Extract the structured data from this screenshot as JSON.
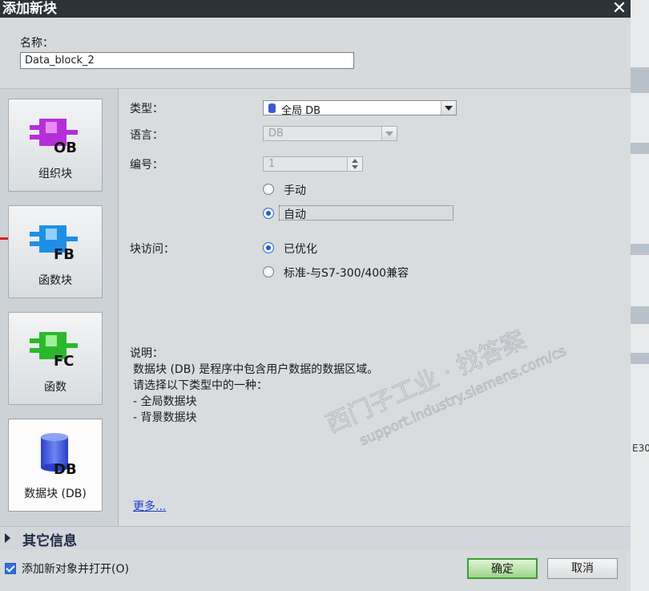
{
  "window": {
    "title": "添加新块",
    "close_icon": "close-icon"
  },
  "name": {
    "label": "名称：",
    "value": "Data_block_2"
  },
  "block_types": [
    {
      "label": "组织块",
      "badge": "OB",
      "color": "#b52fd9",
      "selected": false
    },
    {
      "label": "函数块",
      "badge": "FB",
      "color": "#1f8fe6",
      "selected": false
    },
    {
      "label": "函数",
      "badge": "FC",
      "color": "#2cb82c",
      "selected": false
    },
    {
      "label": "数据块 (DB)",
      "badge": "DB",
      "color": "#3b52d9",
      "selected": true
    }
  ],
  "form": {
    "type_label": "类型：",
    "type_value": "全局 DB",
    "language_label": "语言：",
    "language_value": "DB",
    "number_label": "编号：",
    "number_value": "1",
    "number_manual": "手动",
    "number_auto": "自动",
    "number_mode": "auto",
    "access_label": "块访问：",
    "access_optimized": "已优化",
    "access_standard": "标准-与S7-300/400兼容",
    "access_mode": "optimized"
  },
  "description": {
    "label": "说明：",
    "lines": [
      "数据块 (DB) 是程序中包含用户数据的数据区域。",
      "请选择以下类型中的一种：",
      "- 全局数据块",
      "- 背景数据块"
    ],
    "more_link": "更多..."
  },
  "watermark": {
    "line1": "西门子工业 · 找答案",
    "line2": "support.industry.siemens.com/cs"
  },
  "other_info": {
    "label": "其它信息"
  },
  "footer": {
    "add_open_label": "添加新对象并打开(O)",
    "add_open_checked": true,
    "ok_label": "确定",
    "cancel_label": "取消"
  },
  "background_strip_text": "E30"
}
